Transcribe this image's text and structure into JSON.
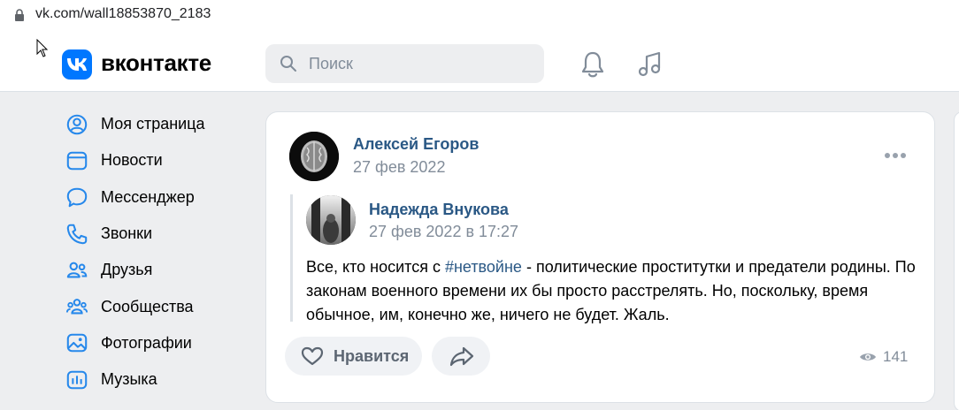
{
  "browser": {
    "url": "vk.com/wall18853870_2183"
  },
  "header": {
    "logo_text": "вконтакте",
    "search_placeholder": "Поиск"
  },
  "sidebar": {
    "items": [
      {
        "label": "Моя страница",
        "icon": "user-circle-icon"
      },
      {
        "label": "Новости",
        "icon": "news-icon"
      },
      {
        "label": "Мессенджер",
        "icon": "message-icon"
      },
      {
        "label": "Звонки",
        "icon": "phone-icon"
      },
      {
        "label": "Друзья",
        "icon": "friends-icon"
      },
      {
        "label": "Сообщества",
        "icon": "communities-icon"
      },
      {
        "label": "Фотографии",
        "icon": "photo-icon"
      },
      {
        "label": "Музыка",
        "icon": "music-icon"
      }
    ]
  },
  "post": {
    "author": "Алексей Егоров",
    "date": "27 фев 2022",
    "repost": {
      "author": "Надежда Внукова",
      "date": "27 фев 2022 в 17:27",
      "text_before": "Все, кто носится с ",
      "hashtag": "#нетвойне",
      "text_after": " - политические проститутки и предатели родины. По законам военного времени их бы просто расстрелять. Но, поскольку, время обычное, им, конечно же, ничего не будет. Жаль."
    },
    "like_label": "Нравится",
    "views": "141"
  },
  "colors": {
    "accent": "#0077ff",
    "link": "#2a5885",
    "secondary_text": "#818c99",
    "background": "#edeef0"
  }
}
